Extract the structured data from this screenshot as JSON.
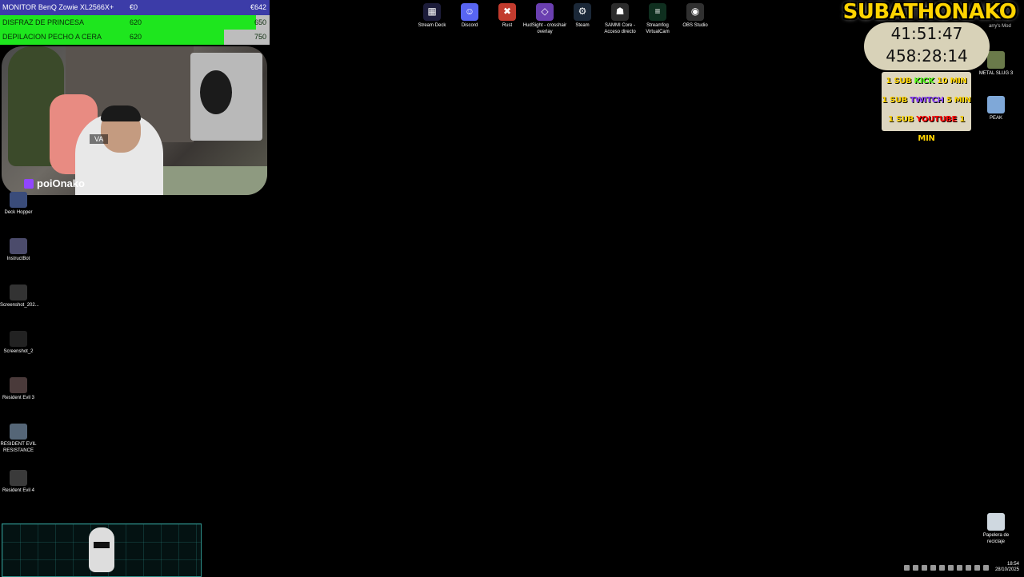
{
  "goals": {
    "rows": [
      {
        "name": "MONITOR BenQ Zowie XL2566X+",
        "current": "€0",
        "target": "€642",
        "progress": 0.0
      },
      {
        "name": "DISFRAZ DE PRINCESA",
        "current": "620",
        "target": "650",
        "progress": 0.95
      },
      {
        "name": "DEPILACION PECHO A CERA",
        "current": "620",
        "target": "750",
        "progress": 0.83
      }
    ]
  },
  "webcam": {
    "channel": "poiOnako",
    "overlay_text": "VA"
  },
  "top_icons": [
    {
      "label": "Stream Deck",
      "icon": "stream-deck-icon",
      "color": "#1c1c3a"
    },
    {
      "label": "Discord",
      "icon": "discord-icon",
      "color": "#5865f2"
    },
    {
      "label": "Rust",
      "icon": "rust-icon",
      "color": "#c23b2e"
    },
    {
      "label": "HudSight - crosshair overlay",
      "icon": "hudsight-icon",
      "color": "#6a3fb0"
    },
    {
      "label": "Steam",
      "icon": "steam-icon",
      "color": "#1b2838"
    },
    {
      "label": "SAMMI Core - Acceso directo",
      "icon": "sammi-icon",
      "color": "#2c2c2c"
    },
    {
      "label": "Streamfog VirtualCam",
      "icon": "streamfog-icon",
      "color": "#0f2f1f"
    },
    {
      "label": "OBS Studio",
      "icon": "obs-icon",
      "color": "#303030"
    }
  ],
  "left_icons": [
    {
      "label": "Deck Hopper",
      "icon": "deck-hopper-icon",
      "color": "#3a4c7a"
    },
    {
      "label": "InstructBot",
      "icon": "instructbot-icon",
      "color": "#4b4b6b"
    },
    {
      "label": "Screenshot_202...",
      "icon": "screenshot-icon",
      "color": "#333333"
    },
    {
      "label": "Screenshot_2",
      "icon": "screenshot-icon",
      "color": "#222222"
    },
    {
      "label": "Resident Evil 3",
      "icon": "resident-evil-3-icon",
      "color": "#4a3a3a"
    },
    {
      "label": "RESIDENT EVIL RESISTANCE",
      "icon": "resident-evil-resistance-icon",
      "color": "#556677"
    },
    {
      "label": "Resident Evil 4",
      "icon": "resident-evil-4-icon",
      "color": "#3a3a3a"
    }
  ],
  "right_icons": [
    {
      "label": "METAL SLUG 3",
      "icon": "metal-slug-3-icon",
      "color": "#6a7a4a"
    },
    {
      "label": "PEAK",
      "icon": "peak-icon",
      "color": "#7fa8d8"
    },
    {
      "label": "Papelera de reciclaje",
      "icon": "recycle-bin-icon",
      "color": "#cfd8e0"
    }
  ],
  "subathon": {
    "title": "SUBATHONAKO",
    "timer1": "41:51:47",
    "timer2": "458:28:14",
    "corner_label": "arry's Mod",
    "rules": [
      {
        "prefix": "1 SUB",
        "platform": "KICK",
        "suffix": "10 MIN",
        "platform_class": "kick"
      },
      {
        "prefix": "1 SUB",
        "platform": "TWITCH",
        "suffix": "5 MIN",
        "platform_class": "twitch"
      },
      {
        "prefix": "1 SUB",
        "platform": "YOUTUBE",
        "suffix": "1 MIN",
        "platform_class": "youtube"
      }
    ]
  },
  "taskbar": {
    "time": "18:54",
    "date": "28/10/2025"
  }
}
